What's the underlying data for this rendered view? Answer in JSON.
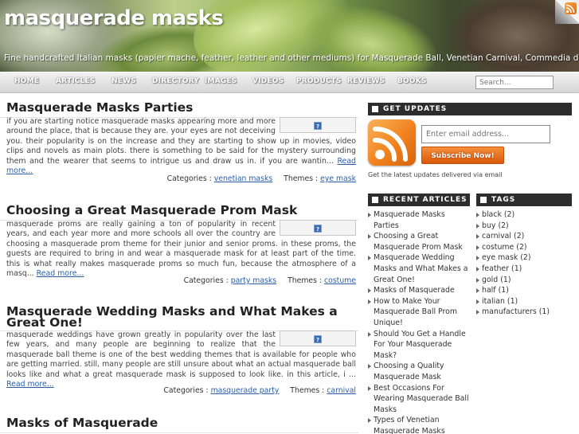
{
  "header": {
    "title": "masquerade masks",
    "tagline": "Fine handcrafted Italian masks (papier mache, feather, leather and other mediums) for Masquerade Ball, Venetian Carnival, Commedia dell Arte, Mardi Gras Party."
  },
  "nav": {
    "items": [
      "HOME",
      "ARTICLES",
      "NEWS",
      "DIRECTORY",
      "IMAGES",
      "VIDEOS",
      "PRODUCTS",
      "REVIEWS",
      "BOOKS"
    ],
    "search_placeholder": "Search..."
  },
  "posts": [
    {
      "title": "Masquerade Masks Parties",
      "excerpt": "if you are starting notice masquerade masks appearing more and more around the place, that is because they are. your eyes are not deceiving you. their popularity is on the increase and they are starting to show up in movies, video clips and novels as main plots. there is something to be said for the mystery surrounding them and the wearer that seems to intrigue us and draw us in. if you are wantin...",
      "read_more": "Read more...",
      "categories_label": "Categories :",
      "category": "venetian masks",
      "themes_label": "Themes :",
      "theme": "eye mask"
    },
    {
      "title": "Choosing a Great Masquerade Prom Mask",
      "excerpt": "masquerade proms are really gaining a ton of popularity in recent years, and each year more and more schools all over the country are choosing a masquerade prom theme for their junior and senior proms. in these proms, the guests are required to bring in and wear a masquerade mask for at least part of the time. this is what really makes masquerade proms so much fun, because the atmosphere of a masq...",
      "read_more": "Read more...",
      "categories_label": "Categories :",
      "category": "party masks",
      "themes_label": "Themes :",
      "theme": "costume"
    },
    {
      "title": "Masquerade Wedding Masks and What Makes a Great One!",
      "excerpt": "masquerade weddings have grown greatly in popularity over the last few years, and many people are beginning to realize that the masquerade ball theme is one of the best wedding themes that is available for people who are getting married. still, many people are still unsure about what an actual masquerade ball looks like and what a great masquerade mask is supposed to look like. in this article, i ...",
      "read_more": "Read more...",
      "categories_label": "Categories :",
      "category": "masquerade party",
      "themes_label": "Themes :",
      "theme": "carnival"
    },
    {
      "title": "Masks of Masquerade"
    }
  ],
  "sidebar": {
    "updates": {
      "heading": "GET UPDATES",
      "email_placeholder": "Enter email address...",
      "subscribe_label": "Subscribe Now!",
      "note": "Get the latest updates delivered via email"
    },
    "recent": {
      "heading": "RECENT ARTICLES",
      "items": [
        "Masquerade Masks Parties",
        "Choosing a Great Masquerade Prom Mask",
        "Masquerade Wedding Masks and What Makes a Great One!",
        "Masks of Masquerade",
        "How to Make Your Masquerade Ball Prom Unique!",
        "Should You Get a Handle For Your Masquerade Mask?",
        "Choosing a Quality Masquerade Mask",
        "Best Occasions For Wearing Masquerade Ball Masks",
        "Types of Venetian Masquerade Masks"
      ]
    },
    "tags": {
      "heading": "TAGS",
      "items": [
        {
          "name": "black",
          "count": "(2)"
        },
        {
          "name": "buy",
          "count": "(2)"
        },
        {
          "name": "carnival",
          "count": "(2)"
        },
        {
          "name": "costume",
          "count": "(2)"
        },
        {
          "name": "eye mask",
          "count": "(2)"
        },
        {
          "name": "feather",
          "count": "(1)"
        },
        {
          "name": "gold",
          "count": "(1)"
        },
        {
          "name": "half",
          "count": "(1)"
        },
        {
          "name": "italian",
          "count": "(1)"
        },
        {
          "name": "manufacturers",
          "count": "(1)"
        }
      ]
    }
  },
  "colors": {
    "link": "#2a5fa8",
    "widget_header": "#2d2d2d",
    "accent_orange": "#f0821e"
  }
}
